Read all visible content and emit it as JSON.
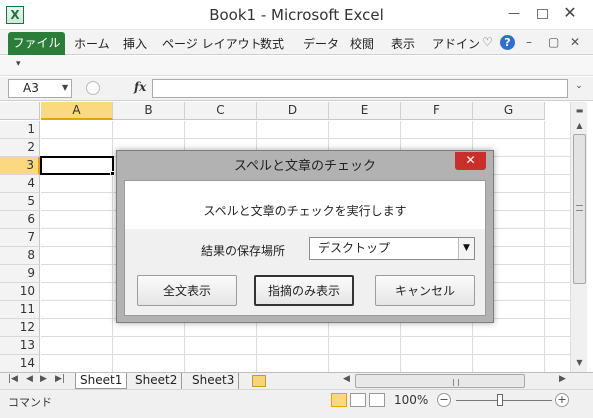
{
  "window": {
    "title": "Book1 - Microsoft Excel",
    "app_icon": "X",
    "controls": {
      "minimize_icon": "minimize-icon",
      "maximize_icon": "maximize-icon",
      "close_icon": "close-icon"
    }
  },
  "ribbon": {
    "file_tab": "ファイル",
    "tabs": [
      "ホーム",
      "挿入",
      "ページ レイアウト",
      "数式",
      "データ",
      "校閲",
      "表示",
      "アドイン"
    ],
    "right_icons": {
      "collapse": "♡",
      "help": "?",
      "min": "–",
      "restore": "▢",
      "close": "✕"
    }
  },
  "quick_access": {
    "customize_icon": "▾"
  },
  "formula_bar": {
    "name_box": "A3",
    "fx": "fx",
    "formula": ""
  },
  "grid": {
    "columns": [
      "A",
      "B",
      "C",
      "D",
      "E",
      "F",
      "G"
    ],
    "rows": [
      "1",
      "2",
      "3",
      "4",
      "5",
      "6",
      "7",
      "8",
      "9",
      "10",
      "11",
      "12",
      "13",
      "14"
    ],
    "selected_column": "A",
    "selected_row": "3"
  },
  "sheet_tabs": {
    "tabs": [
      "Sheet1",
      "Sheet2",
      "Sheet3"
    ],
    "active": "Sheet1"
  },
  "status_bar": {
    "mode": "コマンド",
    "zoom": "100%",
    "zoom_level": 1.0
  },
  "dialog": {
    "title": "スペルと文章のチェック",
    "close_label": "✕",
    "message": "スペルと文章のチェックを実行します",
    "save_location_label": "結果の保存場所",
    "save_location_value": "デスクトップ",
    "buttons": {
      "show_all": "全文表示",
      "show_issues": "指摘のみ表示",
      "cancel": "キャンセル"
    }
  },
  "colors": {
    "file_tab": "#2d7d3a",
    "selection_header": "#fbd980",
    "dialog_close": "#c9302c"
  }
}
